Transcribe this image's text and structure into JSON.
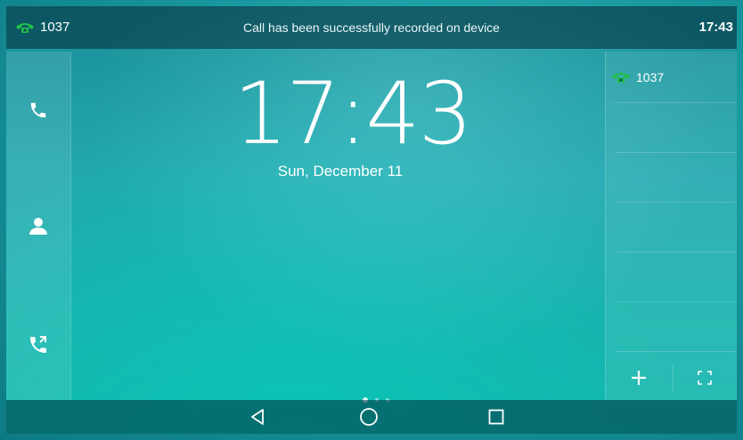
{
  "status": {
    "account": "1037",
    "message": "Call has been successfully recorded on device",
    "time": "17:43",
    "account_icon": "phone-green-icon"
  },
  "sidebar": {
    "items": [
      {
        "name": "dial",
        "icon": "phone-icon"
      },
      {
        "name": "directory",
        "icon": "contact-icon"
      },
      {
        "name": "history",
        "icon": "call-history-icon"
      }
    ]
  },
  "clock": {
    "time": "17:43",
    "date": "Sun, December 11"
  },
  "right_panel": {
    "account": "1037",
    "add_icon": "plus-icon",
    "expand_icon": "expand-icon"
  },
  "pager": {
    "count": 3,
    "active": 0
  },
  "nav": {
    "back": "back-icon",
    "home": "home-icon",
    "recent": "recent-apps-icon"
  },
  "colors": {
    "accent_green": "#1fbf4a",
    "bar_dark": "#0b4b57"
  }
}
